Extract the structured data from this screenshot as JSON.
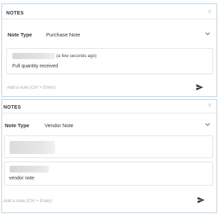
{
  "panels": [
    {
      "title": "NOTES",
      "close_glyph": "×",
      "note_type_label": "Note Type",
      "note_type_value": "Purchase Note",
      "notes": [
        {
          "timestamp": "(a few seconds ago)",
          "text": "Full quantity received"
        }
      ],
      "add_note_placeholder": "Add a note (Ctrl + Enter)"
    },
    {
      "title": "NOTES",
      "close_glyph": "×",
      "note_type_label": "Note Type",
      "note_type_value": "Vendor Note",
      "notes": [
        {
          "text": "vendor note"
        }
      ],
      "add_note_placeholder": "Add a note (Ctrl + Enter)"
    }
  ],
  "icons": {
    "close": "close-icon",
    "chevron": "chevron-down-icon",
    "send": "send-icon"
  }
}
